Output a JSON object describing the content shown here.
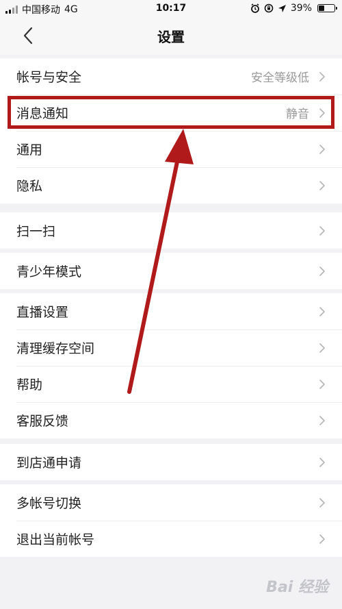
{
  "status_bar": {
    "carrier": "中国移动",
    "network": "4G",
    "time": "10:17",
    "battery": "39%",
    "battery_level": 0.39
  },
  "nav": {
    "title": "设置"
  },
  "groups": [
    {
      "rows": [
        {
          "label": "帐号与安全",
          "value": "安全等级低"
        },
        {
          "label": "消息通知",
          "value": "静音"
        },
        {
          "label": "通用",
          "value": ""
        },
        {
          "label": "隐私",
          "value": ""
        }
      ]
    },
    {
      "rows": [
        {
          "label": "扫一扫",
          "value": ""
        }
      ]
    },
    {
      "rows": [
        {
          "label": "青少年模式",
          "value": ""
        }
      ]
    },
    {
      "rows": [
        {
          "label": "直播设置",
          "value": ""
        },
        {
          "label": "清理缓存空间",
          "value": ""
        },
        {
          "label": "帮助",
          "value": ""
        },
        {
          "label": "客服反馈",
          "value": ""
        }
      ]
    },
    {
      "rows": [
        {
          "label": "到店通申请",
          "value": ""
        }
      ]
    },
    {
      "rows": [
        {
          "label": "多帐号切换",
          "value": ""
        },
        {
          "label": "退出当前帐号",
          "value": ""
        }
      ]
    }
  ],
  "annotation": {
    "highlight_color": "#b01a1a",
    "arrow_color": "#b01a1a"
  },
  "watermark": "Bai 经验"
}
